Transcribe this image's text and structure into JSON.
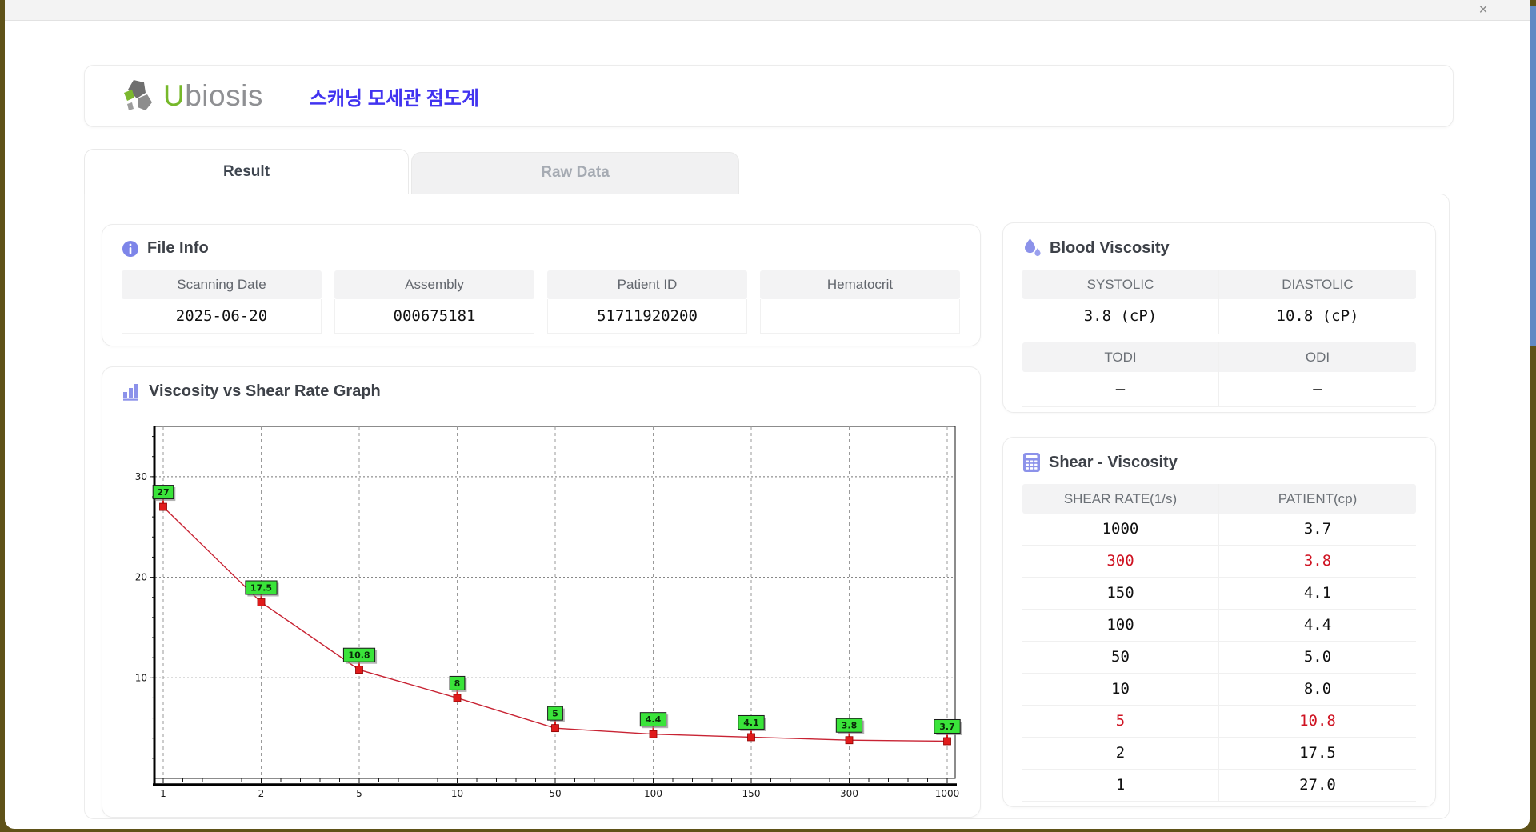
{
  "window": {
    "close_label": "×"
  },
  "header": {
    "logo": {
      "brand_u": "U",
      "brand_rest": "biosis"
    },
    "app_title": "스캐닝 모세관 점도계"
  },
  "tabs": [
    {
      "label": "Result",
      "active": true
    },
    {
      "label": "Raw Data",
      "active": false
    }
  ],
  "file_info": {
    "title": "File Info",
    "fields": [
      {
        "label": "Scanning Date",
        "value": "2025-06-20"
      },
      {
        "label": "Assembly",
        "value": "000675181"
      },
      {
        "label": "Patient ID",
        "value": "51711920200"
      },
      {
        "label": "Hematocrit",
        "value": ""
      }
    ]
  },
  "blood_viscosity": {
    "title": "Blood Viscosity",
    "row1": {
      "labels": [
        "SYSTOLIC",
        "DIASTOLIC"
      ],
      "values": [
        "3.8 (cP)",
        "10.8 (cP)"
      ]
    },
    "row2": {
      "labels": [
        "TODI",
        "ODI"
      ],
      "values": [
        "–",
        "–"
      ]
    }
  },
  "chart_data": {
    "type": "line",
    "title": "Viscosity vs Shear Rate Graph",
    "x_scale": "categorical",
    "categories": [
      1,
      2,
      5,
      10,
      50,
      100,
      150,
      300,
      1000
    ],
    "values": [
      27,
      17.5,
      10.8,
      8,
      5,
      4.4,
      4.1,
      3.8,
      3.7
    ],
    "point_labels": [
      "27",
      "17.5",
      "10.8",
      "8",
      "5",
      "4.4",
      "4.1",
      "3.8",
      "3.7"
    ],
    "xlabel": "",
    "ylabel": "",
    "ylim": [
      0,
      35
    ],
    "yticks": [
      10,
      20,
      30
    ],
    "grid": true,
    "legend": false,
    "colors": {
      "line": "#c82333",
      "marker": "#e01b1b",
      "marker_border": "#8b0000",
      "label_bg": "#3ae43a",
      "label_border": "#1a1a1a"
    }
  },
  "shear_table": {
    "title": "Shear - Viscosity",
    "columns": [
      "SHEAR RATE(1/s)",
      "PATIENT(cp)"
    ],
    "rows": [
      {
        "shear": "1000",
        "patient": "3.7",
        "highlight": false
      },
      {
        "shear": "300",
        "patient": "3.8",
        "highlight": true
      },
      {
        "shear": "150",
        "patient": "4.1",
        "highlight": false
      },
      {
        "shear": "100",
        "patient": "4.4",
        "highlight": false
      },
      {
        "shear": "50",
        "patient": "5.0",
        "highlight": false
      },
      {
        "shear": "10",
        "patient": "8.0",
        "highlight": false
      },
      {
        "shear": "5",
        "patient": "10.8",
        "highlight": true
      },
      {
        "shear": "2",
        "patient": "17.5",
        "highlight": false
      },
      {
        "shear": "1",
        "patient": "27.0",
        "highlight": false
      }
    ]
  },
  "colors": {
    "accent_periwinkle": "#8c92ea",
    "title_blue": "#4133f0",
    "logo_green": "#76b82a",
    "highlight_red": "#cf1322",
    "desktop": "#5f5218",
    "side_strip_blue": "#6089c4"
  }
}
